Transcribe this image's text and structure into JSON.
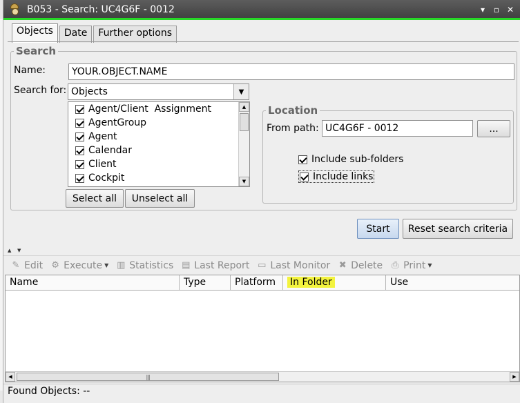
{
  "window": {
    "title": "B053 - Search: UC4G6F - 0012",
    "controls": {
      "minimize": "▾",
      "maximize": "▫",
      "close": "✕"
    }
  },
  "tabs": [
    {
      "label": "Objects",
      "active": true
    },
    {
      "label": "Date",
      "active": false
    },
    {
      "label": "Further options",
      "active": false
    }
  ],
  "search": {
    "legend": "Search",
    "name_label": "Name:",
    "name_value": "YOUR.OBJECT.NAME",
    "search_for_label": "Search for:",
    "search_for_value": "Objects",
    "object_types": [
      {
        "label": "Agent/Client  Assignment",
        "checked": true
      },
      {
        "label": "AgentGroup",
        "checked": true
      },
      {
        "label": "Agent",
        "checked": true
      },
      {
        "label": "Calendar",
        "checked": true
      },
      {
        "label": "Client",
        "checked": true
      },
      {
        "label": "Cockpit",
        "checked": true
      }
    ],
    "select_all_label": "Select all",
    "unselect_all_label": "Unselect all"
  },
  "location": {
    "legend": "Location",
    "from_path_label": "From path:",
    "from_path_value": "UC4G6F - 0012",
    "browse_label": "...",
    "include_subfolders_label": "Include sub-folders",
    "include_subfolders_checked": true,
    "include_links_label": "Include links",
    "include_links_checked": true
  },
  "actions": {
    "start_label": "Start",
    "reset_label": "Reset search criteria"
  },
  "toolbar": {
    "edit": "Edit",
    "execute": "Execute",
    "statistics": "Statistics",
    "last_report": "Last Report",
    "last_monitor": "Last Monitor",
    "delete": "Delete",
    "print": "Print"
  },
  "results": {
    "columns": [
      "Name",
      "Type",
      "Platform",
      "In Folder",
      "Use"
    ],
    "rows": []
  },
  "status": {
    "found_objects": "Found Objects: --"
  },
  "colors": {
    "accent_green": "#27d827",
    "highlight_yellow": "#f3f33e",
    "titlebar": "#4a4a4a"
  }
}
